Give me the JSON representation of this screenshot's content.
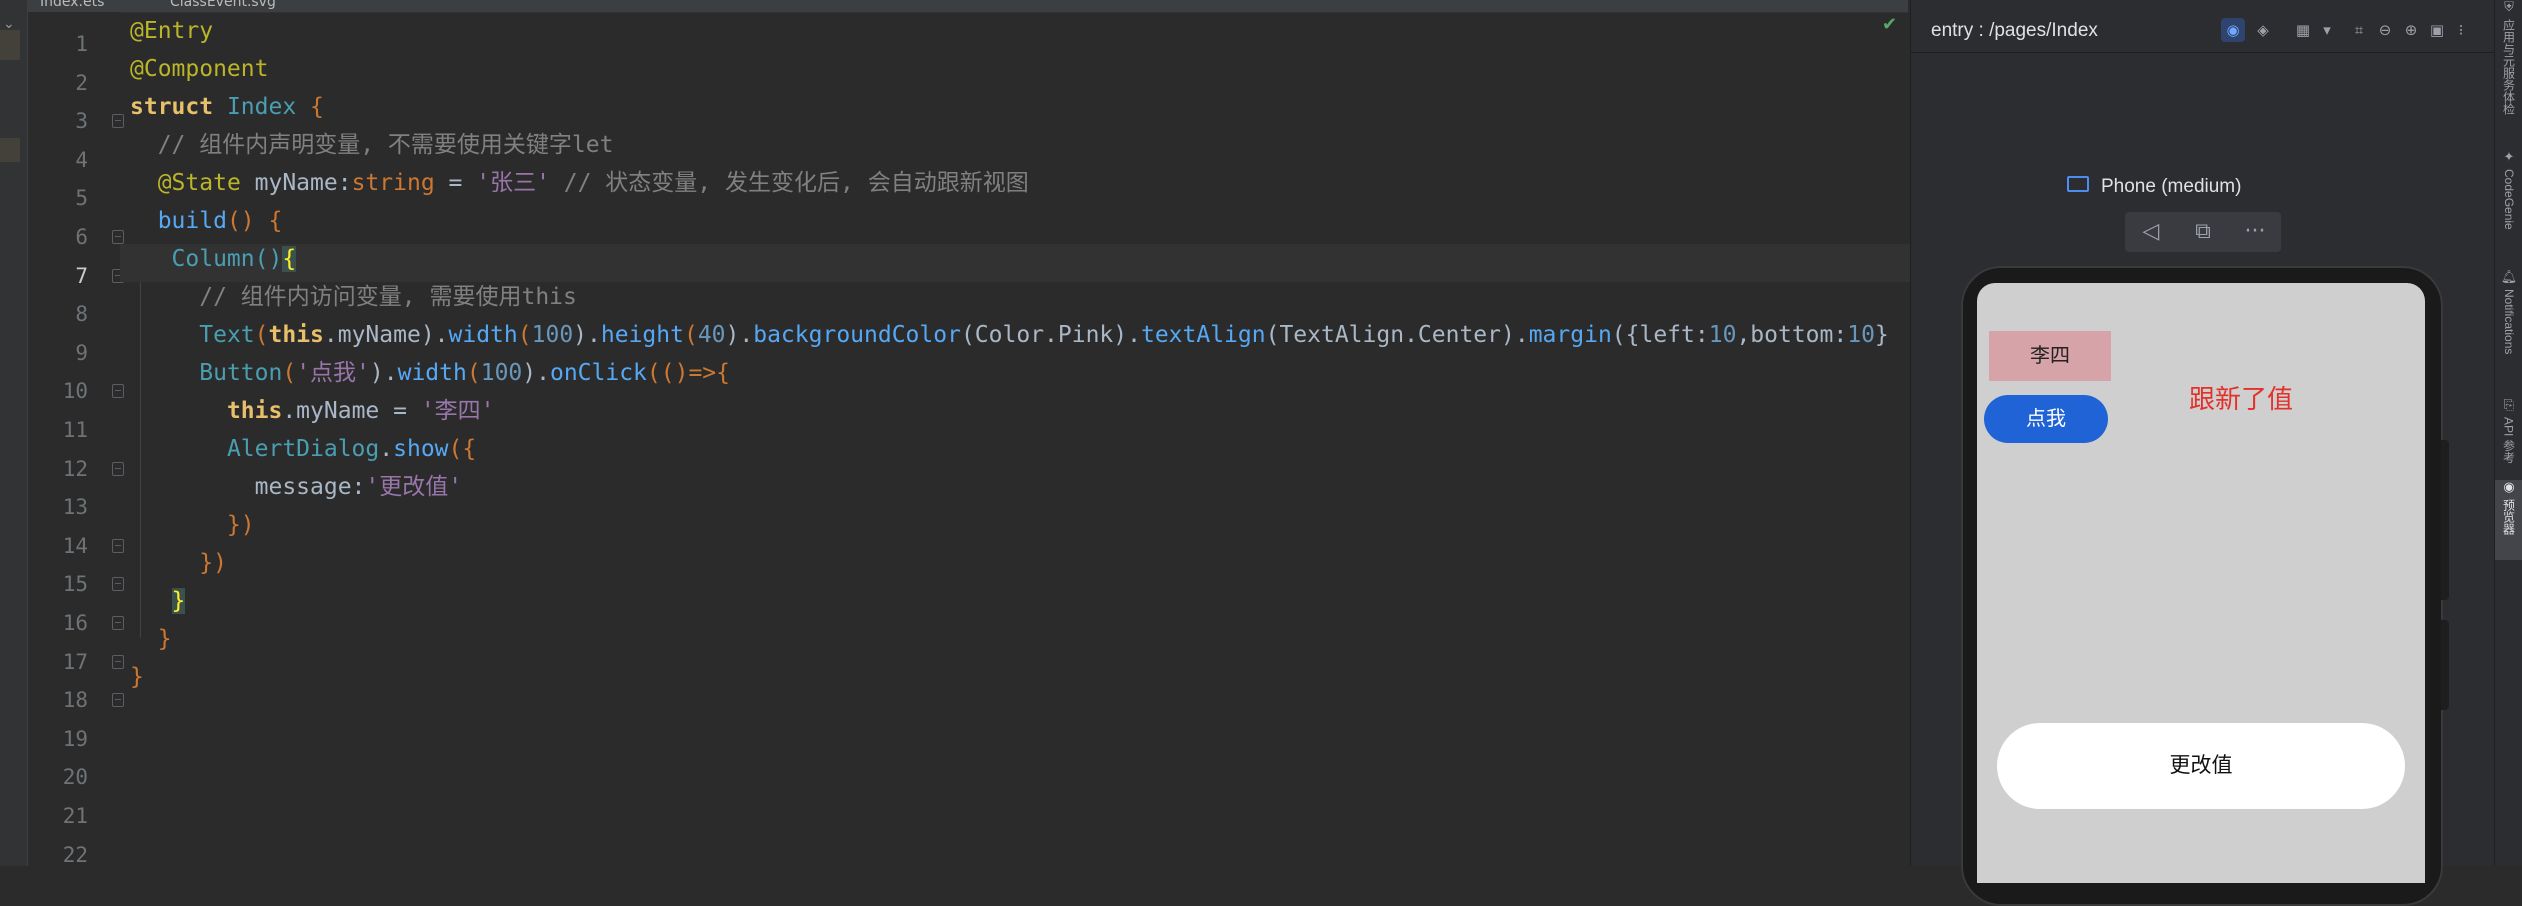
{
  "tabs": [
    {
      "label": "Index.ets"
    },
    {
      "label": "ClassEvent.svg"
    }
  ],
  "editor": {
    "current_line": 7,
    "line_numbers": [
      "1",
      "2",
      "3",
      "4",
      "5",
      "6",
      "7",
      "8",
      "9",
      "10",
      "11",
      "12",
      "13",
      "14",
      "15",
      "16",
      "17",
      "18",
      "19",
      "20",
      "21",
      "22"
    ],
    "lines": {
      "l1": {
        "a": "@Entry"
      },
      "l2": {
        "a": "@Component"
      },
      "l3": {
        "a": "struct",
        "b": " ",
        "c": "Index",
        "d": " {"
      },
      "l4": {
        "a": "  // 组件内声明变量, 不需要使用关键字let"
      },
      "l5": {
        "a": "  ",
        "b": "@State",
        "c": " myName:",
        "d": "string",
        "e": " = ",
        "f": "'张三'",
        "g": " // 状态变量, 发生变化后, 会自动跟新视图"
      },
      "l6": {
        "a": "  ",
        "b": "build",
        "c": "() {"
      },
      "l7": {
        "a": "   Column()",
        "b": "{"
      },
      "l8": {
        "a": "     // 组件内访问变量, 需要使用this"
      },
      "l9": {
        "a": "     ",
        "b": "Text",
        "c": "(",
        "d": "this",
        "e": ".myName).",
        "f": "width",
        "g": "(",
        "h": "100",
        "i": ").",
        "j": "height",
        "k": "(",
        "l": "40",
        "m": ").",
        "n": "backgroundColor",
        "o": "(Color.Pink).",
        "p": "textAlign",
        "q": "(TextAlign.Center).",
        "r": "margin",
        "s": "({left:",
        "t": "10",
        "u": ",bottom:",
        "v": "10",
        "w": "}"
      },
      "l10": {
        "a": "     ",
        "b": "Button",
        "c": "(",
        "d": "'点我'",
        "e": ").",
        "f": "width",
        "g": "(",
        "h": "100",
        "i": ").",
        "j": "onClick",
        "k": "(()=>{"
      },
      "l11": {
        "a": "       ",
        "b": "this",
        "c": ".myName = ",
        "d": "'李四'"
      },
      "l12": {
        "a": "       ",
        "b": "AlertDialog",
        "c": ".",
        "d": "show",
        "e": "({"
      },
      "l13": {
        "a": "         message:",
        "b": "'更改值'"
      },
      "l14": {
        "a": "       })"
      },
      "l15": {
        "a": "     })"
      },
      "l16": {
        "a": "   ",
        "b": "}"
      },
      "l17": {
        "a": "  }"
      },
      "l18": {
        "a": "}"
      }
    }
  },
  "preview": {
    "path": "entry : /pages/Index",
    "device_name": "Phone (medium)",
    "app": {
      "name_text": "李四",
      "button_label": "点我",
      "annotation": "跟新了值",
      "dialog_message": "更改值"
    }
  },
  "right_toolbar": [
    {
      "label": "应用与元服务体检",
      "icon": "health-icon"
    },
    {
      "label": "CodeGenie",
      "icon": "codegenie-icon"
    },
    {
      "label": "Notifications",
      "icon": "bell-icon"
    },
    {
      "label": "API 参考",
      "icon": "api-icon"
    },
    {
      "label": "预览器",
      "icon": "eye-icon"
    }
  ],
  "colors": {
    "editor_bg": "#2b2b2b",
    "keyword": "#cc7832",
    "string": "#9876aa",
    "comment": "#808080",
    "function": "#56a8f5",
    "number": "#6897bb",
    "accent_blue": "#1f63d6",
    "pink": "#d6a3a9",
    "annotation_red": "#e5302a"
  }
}
